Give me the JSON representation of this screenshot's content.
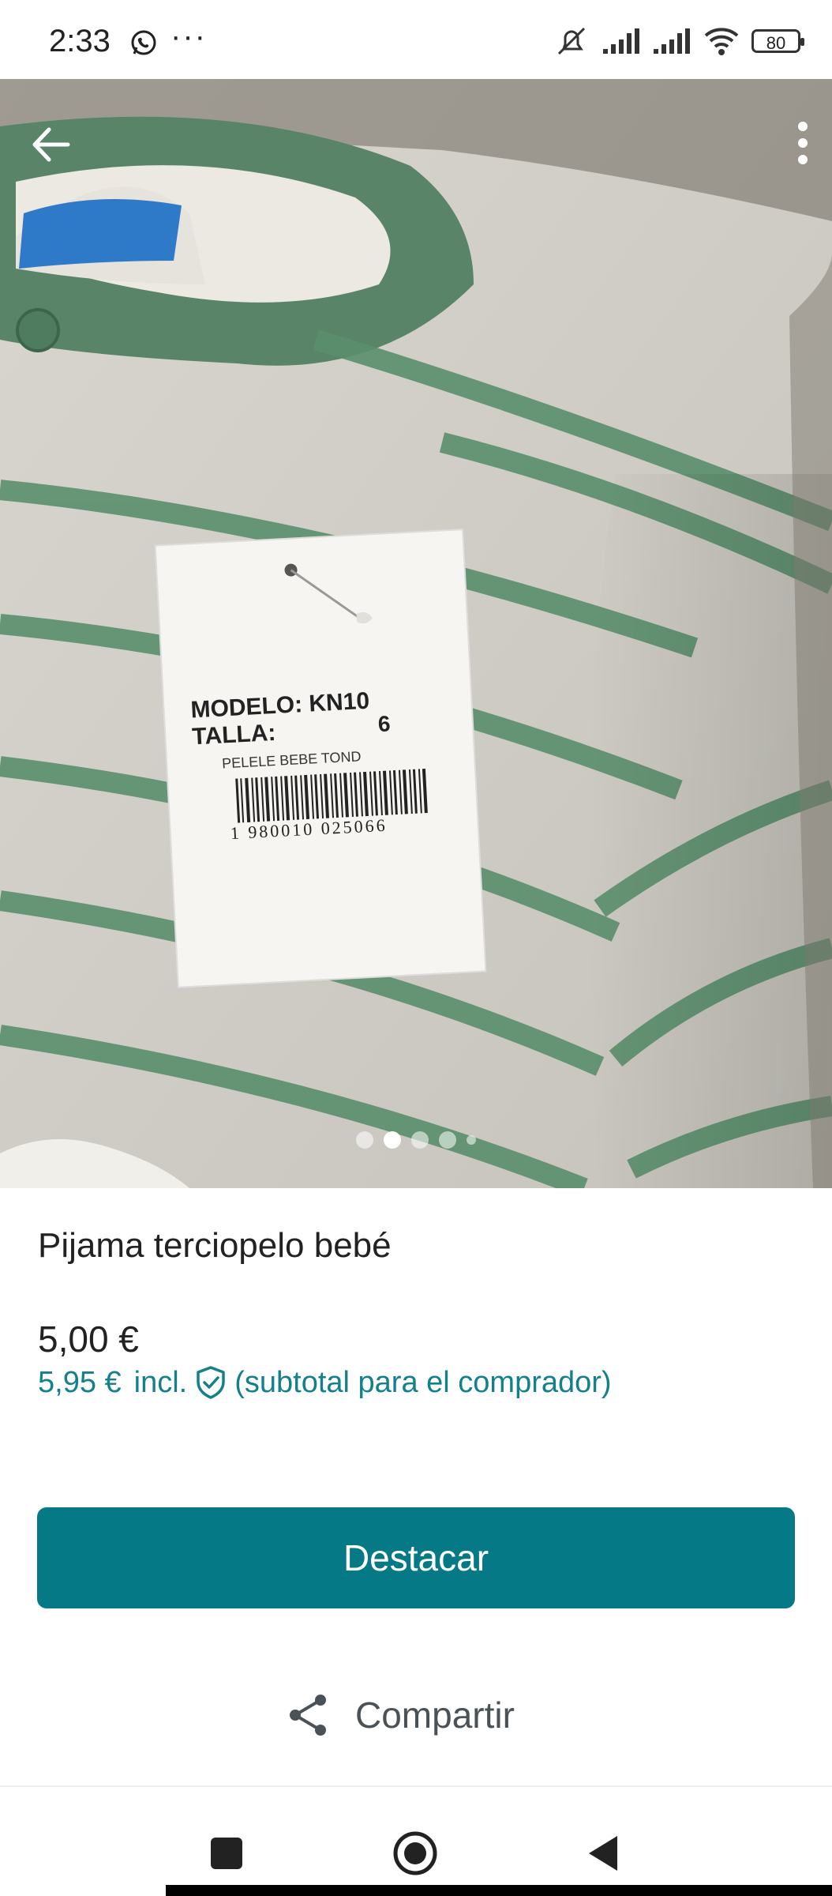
{
  "status_bar": {
    "time": "2:33",
    "more": "···",
    "battery": "80",
    "icons": [
      "whatsapp-icon",
      "mute-icon",
      "signal-icon",
      "signal-icon",
      "wifi-icon",
      "battery-icon"
    ]
  },
  "gallery": {
    "tag_lines": [
      "MODELO: KN10",
      "TALLA:",
      "6",
      "PELELE BEBE TOND",
      "1 980010 025066"
    ],
    "pager": {
      "count": 5,
      "active_index": 1
    }
  },
  "listing": {
    "title": "Pijama terciopelo bebé",
    "price": "5,00 €",
    "price_with_fee": "5,95 €",
    "incl_label": "incl.",
    "subtotal_note": "(subtotal para el comprador)"
  },
  "actions": {
    "primary_label": "Destacar",
    "share_label": "Compartir"
  },
  "colors": {
    "accent": "#057a86",
    "accent_text": "#13808a",
    "stripe_green": "#5a8f6c"
  }
}
